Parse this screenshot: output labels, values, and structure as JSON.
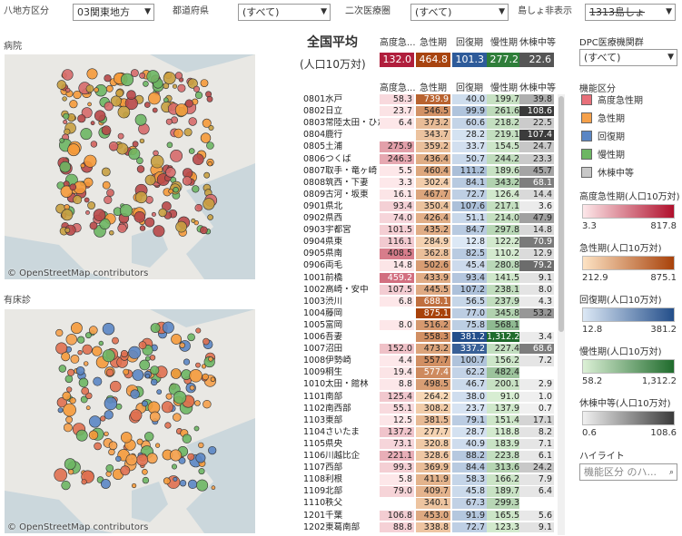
{
  "filters": {
    "region": {
      "label": "八地方区分",
      "value": "03関東地方"
    },
    "pref": {
      "label": "都道府県",
      "value": "(すべて)"
    },
    "area2": {
      "label": "二次医療圏",
      "value": "(すべて)"
    },
    "island": {
      "label": "島しょ非表示",
      "value": "1313島しょ"
    }
  },
  "maps": {
    "top_label": "病院",
    "bottom_label": "有床診",
    "attribution": "© OpenStreetMap contributors"
  },
  "table": {
    "avg_title": "全国平均",
    "avg_sub": "(人口10万対)",
    "headers": [
      "高度急...",
      "急性期",
      "回復期",
      "慢性期",
      "休棟中等"
    ],
    "headers2": [
      "高度急...",
      "急性期",
      "回復期",
      "慢性期",
      "休棟中等"
    ],
    "avg": [
      "132.0",
      "464.8",
      "101.3",
      "277.2",
      "22.6"
    ],
    "rows": [
      [
        "0801水戸",
        "58.3",
        "739.9",
        "40.0",
        "199.7",
        "39.8"
      ],
      [
        "0802日立",
        "23.7",
        "546.5",
        "99.9",
        "261.6",
        "108.6"
      ],
      [
        "0803常陸太田・ひた...",
        "6.4",
        "373.2",
        "60.6",
        "218.2",
        "22.5"
      ],
      [
        "0804鹿行",
        "",
        "343.7",
        "28.2",
        "219.1",
        "107.4"
      ],
      [
        "0805土浦",
        "275.9",
        "359.2",
        "33.7",
        "154.5",
        "24.7"
      ],
      [
        "0806つくば",
        "246.3",
        "436.4",
        "50.7",
        "244.2",
        "23.3"
      ],
      [
        "0807取手・竜ヶ崎",
        "5.5",
        "460.4",
        "111.2",
        "189.6",
        "45.7"
      ],
      [
        "0808筑西・下妻",
        "3.3",
        "302.4",
        "84.1",
        "343.2",
        "68.1"
      ],
      [
        "0809古河・坂東",
        "16.1",
        "467.7",
        "72.7",
        "126.4",
        "14.4"
      ],
      [
        "0901県北",
        "93.4",
        "350.4",
        "107.6",
        "217.1",
        "3.6"
      ],
      [
        "0902県西",
        "74.0",
        "426.4",
        "51.1",
        "214.0",
        "47.9"
      ],
      [
        "0903宇都宮",
        "101.5",
        "435.2",
        "84.7",
        "297.8",
        "14.8"
      ],
      [
        "0904県東",
        "116.1",
        "284.9",
        "12.8",
        "122.2",
        "70.9"
      ],
      [
        "0905県南",
        "408.5",
        "362.8",
        "82.5",
        "110.2",
        "12.9"
      ],
      [
        "0906両毛",
        "14.8",
        "502.6",
        "45.4",
        "280.8",
        "79.2"
      ],
      [
        "1001前橋",
        "459.2",
        "433.9",
        "93.4",
        "141.5",
        "9.1"
      ],
      [
        "1002高崎・安中",
        "107.5",
        "445.5",
        "107.2",
        "238.1",
        "8.0"
      ],
      [
        "1003渋川",
        "6.8",
        "688.1",
        "56.5",
        "237.9",
        "4.3"
      ],
      [
        "1004藤岡",
        "",
        "875.1",
        "77.0",
        "345.8",
        "53.2"
      ],
      [
        "1005富岡",
        "8.0",
        "516.2",
        "75.8",
        "568.1",
        ""
      ],
      [
        "1006吾妻",
        "",
        "558.3",
        "381.2",
        "1,312.2",
        "3.4"
      ],
      [
        "1007沼田",
        "152.0",
        "473.2",
        "337.2",
        "227.4",
        "68.6"
      ],
      [
        "1008伊勢崎",
        "4.4",
        "557.7",
        "100.7",
        "156.2",
        "7.2"
      ],
      [
        "1009桐生",
        "19.4",
        "577.4",
        "62.2",
        "482.4",
        ""
      ],
      [
        "1010太田・館林",
        "8.8",
        "498.5",
        "46.7",
        "200.1",
        "2.9"
      ],
      [
        "1101南部",
        "125.4",
        "264.2",
        "38.0",
        "91.0",
        "1.0"
      ],
      [
        "1102南西部",
        "55.1",
        "308.2",
        "23.7",
        "137.9",
        "0.7"
      ],
      [
        "1103東部",
        "12.5",
        "381.5",
        "79.1",
        "151.4",
        "17.1"
      ],
      [
        "1104さいたま",
        "137.2",
        "277.7",
        "28.7",
        "118.8",
        "8.2"
      ],
      [
        "1105県央",
        "73.1",
        "320.8",
        "40.9",
        "183.9",
        "7.1"
      ],
      [
        "1106川越比企",
        "221.1",
        "328.6",
        "88.2",
        "223.8",
        "6.1"
      ],
      [
        "1107西部",
        "99.3",
        "369.9",
        "84.4",
        "313.6",
        "24.2"
      ],
      [
        "1108利根",
        "5.8",
        "411.9",
        "58.3",
        "166.2",
        "7.9"
      ],
      [
        "1109北部",
        "79.0",
        "409.7",
        "45.8",
        "189.7",
        "6.4"
      ],
      [
        "1110秩父",
        "",
        "340.1",
        "67.3",
        "299.3",
        ""
      ],
      [
        "1201千葉",
        "106.8",
        "453.0",
        "91.9",
        "165.5",
        "5.6"
      ],
      [
        "1202東葛南部",
        "88.8",
        "338.8",
        "72.7",
        "123.3",
        "9.1"
      ]
    ]
  },
  "right": {
    "dpc_label": "DPC医療機関群",
    "dpc_value": "(すべて)",
    "func_label": "機能区分",
    "legend": [
      {
        "label": "高度急性期",
        "color": "#e8707a"
      },
      {
        "label": "急性期",
        "color": "#f5a04a"
      },
      {
        "label": "回復期",
        "color": "#5b86c4"
      },
      {
        "label": "慢性期",
        "color": "#6db663"
      },
      {
        "label": "休棟中等",
        "color": "#c8c8c8"
      }
    ],
    "gradients": [
      {
        "title": "高度急性期(人口10万対)",
        "min": "3.3",
        "max": "817.8",
        "c1": "#fde8ea",
        "c2": "#b0102c"
      },
      {
        "title": "急性期(人口10万対)",
        "min": "212.9",
        "max": "875.1",
        "c1": "#fde3c4",
        "c2": "#a8420a"
      },
      {
        "title": "回復期(人口10万対)",
        "min": "12.8",
        "max": "381.2",
        "c1": "#dce8f5",
        "c2": "#234e8a"
      },
      {
        "title": "慢性期(人口10万対)",
        "min": "58.2",
        "max": "1,312.2",
        "c1": "#dcf0d6",
        "c2": "#1f6b2c"
      },
      {
        "title": "休棟中等(人口10万対)",
        "min": "0.6",
        "max": "108.6",
        "c1": "#f0f0f0",
        "c2": "#3a3a3a"
      }
    ],
    "highlight_label": "ハイライト",
    "highlight_placeholder": "機能区分 のハ..."
  }
}
